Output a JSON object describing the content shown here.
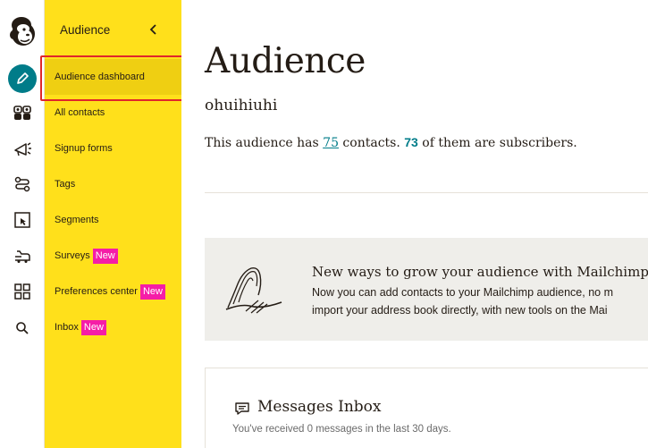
{
  "rail": {
    "icons": [
      "mailchimp-logo-icon",
      "create-pencil-icon",
      "audience-icon",
      "campaigns-megaphone-icon",
      "automations-icon",
      "website-icon",
      "integrations-icon",
      "apps-grid-icon",
      "search-icon"
    ]
  },
  "nav": {
    "title": "Audience",
    "items": [
      {
        "label": "Audience dashboard",
        "badge": ""
      },
      {
        "label": "All contacts",
        "badge": ""
      },
      {
        "label": "Signup forms",
        "badge": ""
      },
      {
        "label": "Tags",
        "badge": ""
      },
      {
        "label": "Segments",
        "badge": ""
      },
      {
        "label": "Surveys",
        "badge": "New"
      },
      {
        "label": "Preferences center",
        "badge": "New"
      },
      {
        "label": "Inbox",
        "badge": "New"
      }
    ]
  },
  "main": {
    "title": "Audience",
    "audience_name": "ohuihiuhi",
    "stats": {
      "prefix": "This audience has ",
      "contacts": "75",
      "middle": " contacts. ",
      "subscribers": "73",
      "suffix": " of them are subscribers."
    },
    "promo": {
      "title": "New ways to grow your audience with Mailchimp's n",
      "line1": "Now you can add contacts to your Mailchimp audience, no m",
      "line2": "import your address book directly, with new tools on the Mai"
    },
    "inbox_card": {
      "title": "Messages Inbox",
      "text": "You've received 0 messages in the last 30 days."
    }
  },
  "colors": {
    "nav_yellow": "#ffe01b",
    "selected_yellow": "#efcf12",
    "accent_teal": "#007c89",
    "badge_pink": "#f51da7",
    "highlight_red": "#e0262a"
  }
}
